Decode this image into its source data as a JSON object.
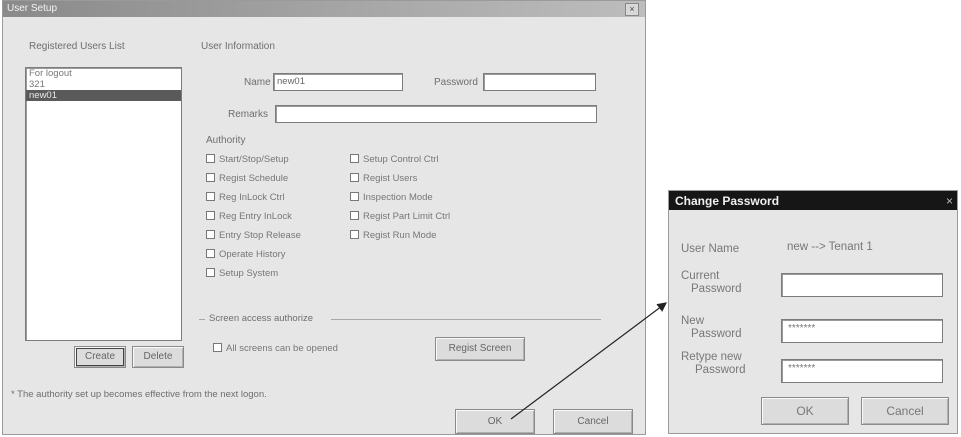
{
  "user_setup": {
    "title": "User Setup",
    "close_glyph": "×",
    "list_label": "Registered Users List",
    "users": [
      "For logout",
      "321",
      "new01"
    ],
    "selected_user_index": 2,
    "buttons": {
      "create": "Create",
      "delete": "Delete",
      "regist_screen": "Regist Screen",
      "ok": "OK",
      "cancel": "Cancel"
    },
    "user_info": {
      "group_label": "User Information",
      "name_label": "Name",
      "name_value": "new01",
      "password_label": "Password",
      "password_value": "",
      "remarks_label": "Remarks",
      "remarks_value": ""
    },
    "authority": {
      "label": "Authority",
      "left": [
        "Start/Stop/Setup",
        "Regist Schedule",
        "Reg InLock Ctrl",
        "Reg Entry InLock",
        "Entry Stop Release",
        "Operate History",
        "Setup System"
      ],
      "right": [
        "Setup Control Ctrl",
        "Regist Users",
        "Inspection Mode",
        "Regist Part Limit Ctrl",
        "Regist Run Mode"
      ]
    },
    "screen_access": {
      "label": "Screen access authorize",
      "checkbox_label": "All screens can be opened"
    },
    "footnote": "* The authority set up becomes effective from the next logon."
  },
  "change_password": {
    "title": "Change Password",
    "close_glyph": "×",
    "user_name_label": "User Name",
    "user_name_value": "new --> Tenant 1",
    "current_label_1": "Current",
    "current_label_2": "Password",
    "current_value": "",
    "new_label_1": "New",
    "new_label_2": "Password",
    "new_value": "*******",
    "retype_label_1": "Retype new",
    "retype_label_2": "Password",
    "retype_value": "*******",
    "ok": "OK",
    "cancel": "Cancel"
  },
  "colors": {
    "selection": "#5a5a5a",
    "dialog_title": "#161616",
    "window_bg": "#e6e6e6"
  }
}
